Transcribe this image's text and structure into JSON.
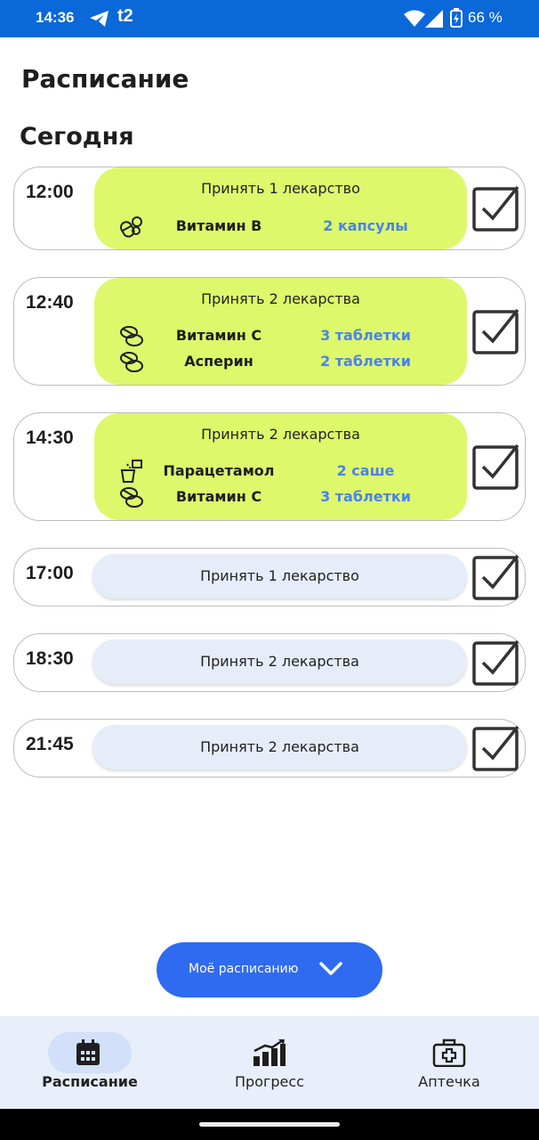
{
  "status_bar": {
    "time": "14:36",
    "carrier": "t2",
    "battery_percent": "66 %",
    "icons": [
      "telegram-icon",
      "wifi-icon",
      "signal-icon",
      "battery-icon"
    ]
  },
  "page": {
    "title": "Расписание",
    "section": "Сегодня"
  },
  "schedule": [
    {
      "time": "12:00",
      "summary": "Принять 1 лекарство",
      "expanded": true,
      "meds": [
        {
          "name": "Витамин B",
          "dose": "2 капсулы",
          "icon": "capsule-icon"
        }
      ]
    },
    {
      "time": "12:40",
      "summary": "Принять 2 лекарства",
      "expanded": true,
      "meds": [
        {
          "name": "Витамин C",
          "dose": "3 таблетки",
          "icon": "tablets-icon"
        },
        {
          "name": "Асперин",
          "dose": "2 таблетки",
          "icon": "tablets-icon"
        }
      ]
    },
    {
      "time": "14:30",
      "summary": "Принять 2 лекарства",
      "expanded": true,
      "meds": [
        {
          "name": "Парацетамол",
          "dose": "2 саше",
          "icon": "sachet-icon"
        },
        {
          "name": "Витамин C",
          "dose": "3 таблетки",
          "icon": "tablets-icon"
        }
      ]
    },
    {
      "time": "17:00",
      "summary": "Принять 1 лекарство",
      "expanded": false,
      "meds": []
    },
    {
      "time": "18:30",
      "summary": "Принять 2 лекарства",
      "expanded": false,
      "meds": []
    },
    {
      "time": "21:45",
      "summary": "Принять 2 лекарства",
      "expanded": false,
      "meds": []
    }
  ],
  "fab": {
    "label": "Моё расписанию",
    "icon": "chevron-down-icon"
  },
  "nav": {
    "items": [
      {
        "label": "Расписание",
        "icon": "calendar-icon",
        "active": true
      },
      {
        "label": "Прогресс",
        "icon": "chart-icon",
        "active": false
      },
      {
        "label": "Аптечка",
        "icon": "first-aid-kit-icon",
        "active": false
      }
    ]
  },
  "colors": {
    "status_bar": "#0a68d9",
    "active_panel": "#ddf86b",
    "inactive_pill": "#e6ecf8",
    "dose_text": "#4b83e8",
    "fab": "#2f6bf0",
    "nav_background": "#e8eefa"
  }
}
